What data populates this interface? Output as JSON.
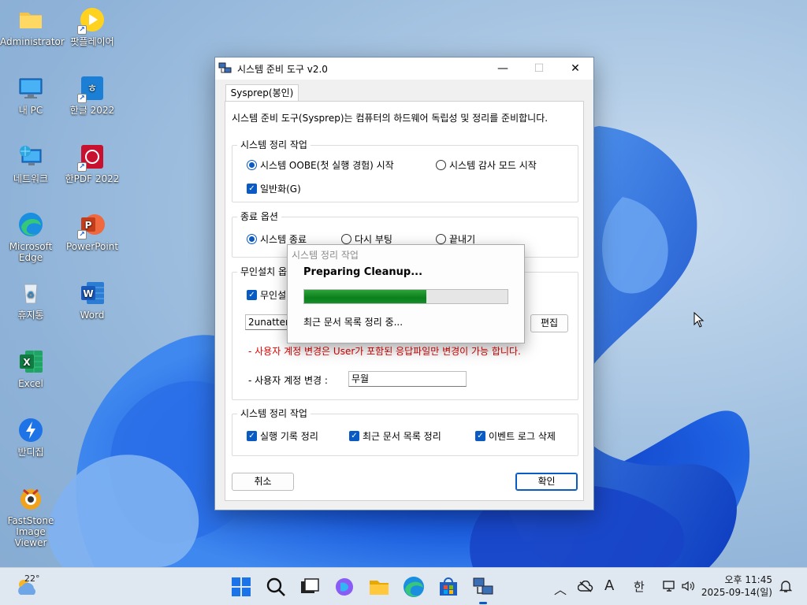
{
  "desktop": {
    "icons": [
      {
        "label": "Administrator"
      },
      {
        "label": "팟플레이어"
      },
      {
        "label": "내 PC"
      },
      {
        "label": "한글 2022"
      },
      {
        "label": "네트워크"
      },
      {
        "label": "한PDF 2022"
      },
      {
        "label": "Microsoft Edge"
      },
      {
        "label": "PowerPoint"
      },
      {
        "label": "휴지통"
      },
      {
        "label": "Word"
      },
      {
        "label": "Excel"
      },
      {
        "label": "반디집"
      },
      {
        "label": "FastStone Image Viewer"
      }
    ]
  },
  "window": {
    "title": "시스템 준비 도구 v2.0",
    "tab_label": "Sysprep(봉인)",
    "description": "시스템 준비 도구(Sysprep)는 컴퓨터의 하드웨어 독립성 및 정리를 준비합니다.",
    "cleanup_action": {
      "legend": "시스템 정리 작업",
      "oobe_label": "시스템 OOBE(첫 실행 경험) 시작",
      "audit_label": "시스템 감사 모드 시작",
      "generalize_label": "일반화(G)",
      "selected": "oobe",
      "generalize_checked": true
    },
    "shutdown_options": {
      "legend": "종료 옵션",
      "shutdown_label": "시스템 종료",
      "reboot_label": "다시 부팅",
      "quit_label": "끝내기",
      "selected": "shutdown"
    },
    "unattend": {
      "legend": "무인설치 옵",
      "checkbox_label": "무인설",
      "file_value": "2unattend",
      "edit_label": "편집",
      "warning": "- 사용자 계정 변경은 User가 포함된 응답파일만 변경이 가능 합니다.",
      "account_label": "- 사용자 계정 변경 :",
      "account_value": "무월"
    },
    "cleanup_tasks": {
      "legend": "시스템 정리 작업",
      "history_label": "실행 기록 정리",
      "recent_docs_label": "최근 문서 목록 정리",
      "event_log_label": "이벤트 로그 삭제"
    },
    "cancel_label": "취소",
    "ok_label": "확인"
  },
  "progress_popup": {
    "title": "시스템 정리 작업",
    "heading": "Preparing Cleanup...",
    "progress": 0.6,
    "status": "최근 문서 목록 정리 중..."
  },
  "taskbar": {
    "weather_temp": "22°",
    "clock_time": "오후 11:45",
    "clock_date": "2025-09-14(일)",
    "ime_mode": "A",
    "ime_lang": "한"
  },
  "colors": {
    "accent": "#0a5ac4",
    "progress": "#0b7f1c",
    "warning": "#e00000"
  }
}
